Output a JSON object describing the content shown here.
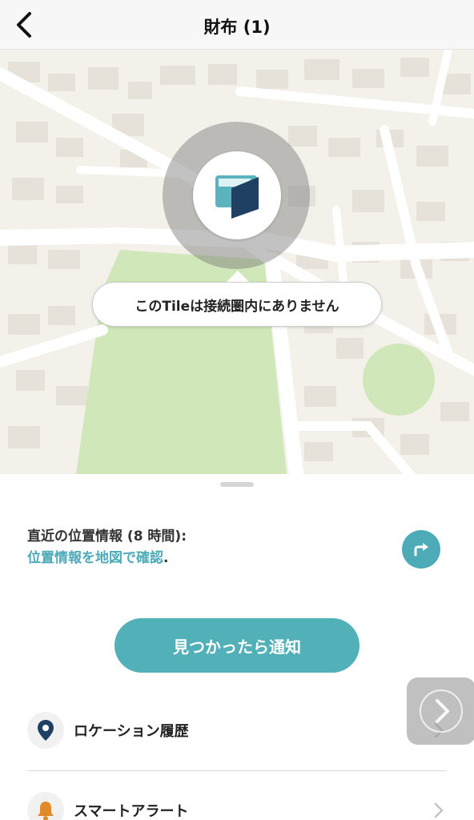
{
  "header": {
    "title": "財布 (1)",
    "back_icon": "chevron-left-icon"
  },
  "map": {
    "callout_text": "このTileは接続圏内にありません",
    "marker_icon": "wallet-tile-icon",
    "colors": {
      "park": "#cfe7b9",
      "road": "#ffffff",
      "building": "#e6e2da",
      "land": "#f4f1eb"
    }
  },
  "sheet": {
    "location_title": "直近の位置情報 (8 時間):",
    "location_link": "位置情報を地図で確認",
    "location_link_suffix": ".",
    "directions_icon": "directions-arrow-icon",
    "notify_button": "見つかったら通知",
    "items": [
      {
        "label": "ロケーション履歴",
        "icon": "location-pin-icon"
      },
      {
        "label": "スマートアラート",
        "icon": "bell-icon"
      }
    ]
  },
  "colors": {
    "accent": "#52b0b8",
    "link": "#4daab7",
    "pin": "#1f3f63",
    "bell": "#e08a2a"
  }
}
